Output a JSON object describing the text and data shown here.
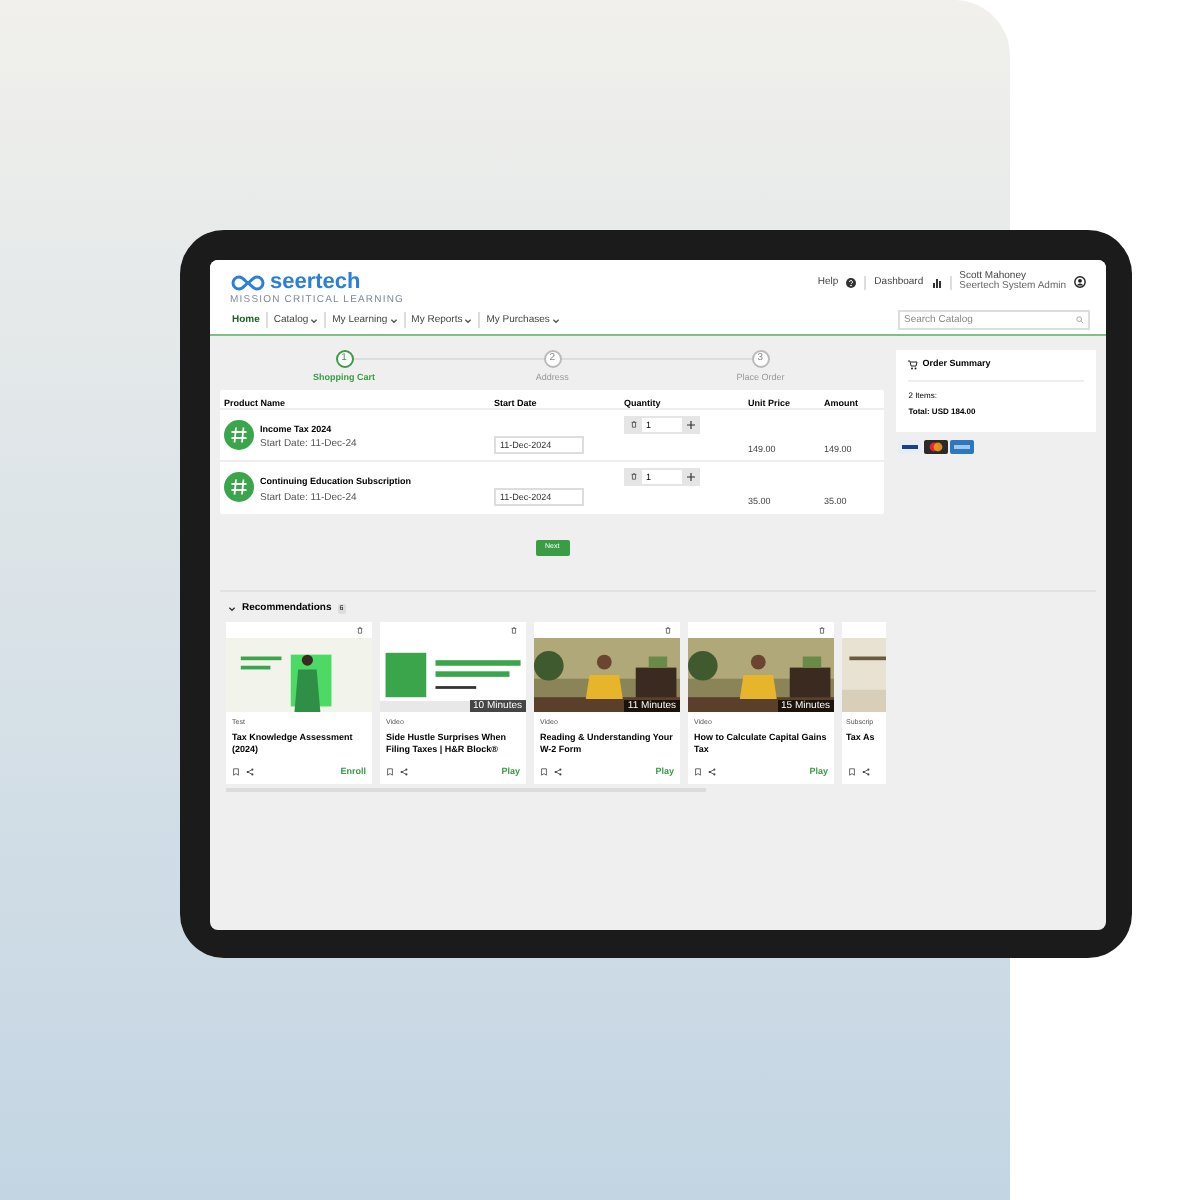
{
  "header": {
    "logo": "seertech",
    "tagline": "MISSION CRITICAL LEARNING",
    "help": "Help",
    "dashboard": "Dashboard",
    "user_name": "Scott Mahoney",
    "user_role": "Seertech System Admin"
  },
  "nav": [
    {
      "label": "Home",
      "selected": true,
      "has_menu": false
    },
    {
      "label": "Catalog",
      "selected": false,
      "has_menu": true
    },
    {
      "label": "My Learning",
      "selected": false,
      "has_menu": true
    },
    {
      "label": "My Reports",
      "selected": false,
      "has_menu": true
    },
    {
      "label": "My Purchases",
      "selected": false,
      "has_menu": true
    }
  ],
  "search": {
    "placeholder": "Search Catalog"
  },
  "steps": [
    {
      "number": "1",
      "label": "Shopping Cart",
      "selected": true
    },
    {
      "number": "2",
      "label": "Address",
      "selected": false
    },
    {
      "number": "3",
      "label": "Place Order",
      "selected": false
    }
  ],
  "cart": {
    "columns": [
      "Product Name",
      "Start Date",
      "Quantity",
      "Unit Price",
      "Amount"
    ],
    "rows": [
      {
        "name": "Income Tax 2024",
        "start_note": "Start Date: 11-Dec-24",
        "start_date": "11-Dec-2024",
        "quantity": "1",
        "unit_price": "149.00",
        "amount": "149.00"
      },
      {
        "name": "Continuing Education Subscription",
        "start_note": "Start Date: 11-Dec-24",
        "start_date": "11-Dec-2024",
        "quantity": "1",
        "unit_price": "35.00",
        "amount": "35.00"
      }
    ]
  },
  "next_button": "Next",
  "order_summary": {
    "title": "Order Summary",
    "items": "2 Items:",
    "total": "Total: USD 184.00"
  },
  "recommendations": {
    "title": "Recommendations",
    "count": "6",
    "cards": [
      {
        "type": "Test",
        "title": "Tax Knowledge Assessment (2024)",
        "action": "Enroll",
        "cut": false
      },
      {
        "type": "Video",
        "title": "Side Hustle Surprises When Filing Taxes | H&R Block®",
        "action": "Play",
        "duration": "10 Minutes",
        "cut": false
      },
      {
        "type": "Video",
        "title": "Reading & Understanding Your W-2 Form",
        "action": "Play",
        "duration": "11 Minutes",
        "cut": false
      },
      {
        "type": "Video",
        "title": "How to Calculate Capital Gains Tax",
        "action": "Play",
        "duration": "15 Minutes",
        "cut": false
      },
      {
        "type": "Subscrip",
        "title": "Tax As",
        "cut": true
      }
    ]
  }
}
